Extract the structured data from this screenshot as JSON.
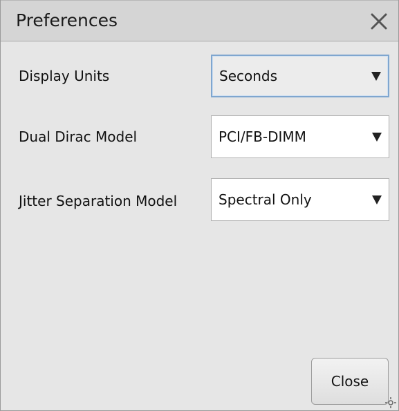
{
  "dialog": {
    "title": "Preferences",
    "close_icon": "close-x-icon"
  },
  "fields": [
    {
      "label": "Display Units",
      "value": "Seconds",
      "focused": true
    },
    {
      "label": "Dual Dirac Model",
      "value": "PCI/FB-DIMM",
      "focused": false
    },
    {
      "label": "Jitter Separation Model",
      "value": "Spectral Only",
      "focused": false
    }
  ],
  "footer": {
    "close_label": "Close"
  },
  "icons": {
    "dropdown": "dropdown-arrow-icon",
    "resize": "resize-grip-icon"
  },
  "colors": {
    "dialog_bg": "#e6e6e6",
    "titlebar_bg": "#d5d5d5",
    "focus_border": "#7fa6cf"
  }
}
